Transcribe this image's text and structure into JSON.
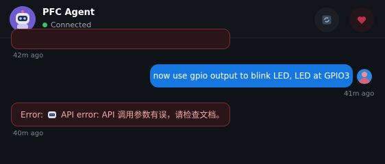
{
  "header": {
    "title": "PFC Agent",
    "status": "Connected",
    "icons": {
      "avatar": "robot-icon",
      "refresh": "refresh-icon",
      "heart": "heart-icon"
    }
  },
  "messages": [
    {
      "role": "assistant",
      "type": "error",
      "text": "",
      "time": "42m ago"
    },
    {
      "role": "user",
      "text": "now use gpio output to blink LED, LED at GPIO3",
      "time": "41m ago"
    },
    {
      "role": "assistant",
      "type": "error",
      "prefix": "Error:",
      "text": "API error: API 调用参数有误，请检查文档。",
      "time": "40m ago"
    }
  ],
  "colors": {
    "user_bubble": "#1677e0",
    "error_bg": "#2a1618",
    "error_border": "#7a2d33",
    "connected": "#35c46a"
  }
}
